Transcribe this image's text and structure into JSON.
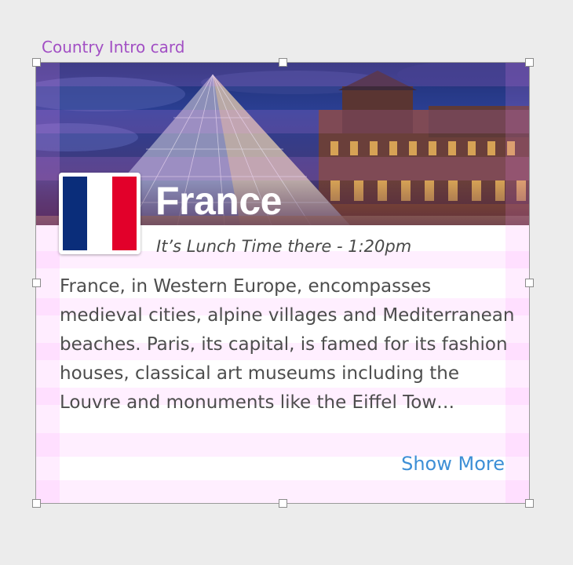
{
  "canvas": {
    "frame_label": "Country Intro card"
  },
  "card": {
    "hero_image": "louvre-pyramid-photo",
    "flag_icon": "france-flag-icon",
    "flag_colors": [
      "#0a2d7a",
      "#ffffff",
      "#e2002a"
    ],
    "country_name": "France",
    "local_time_text": "It’s Lunch Time there - 1:20pm",
    "description": "France, in Western Europe, encompasses medieval cities, alpine villages and Mediterranean beaches. Paris, its capital, is famed for its fashion houses, classical art museums including the Louvre and monuments like the Eiffel Tow…",
    "show_more_label": "Show More",
    "link_color": "#3d8fd6"
  }
}
